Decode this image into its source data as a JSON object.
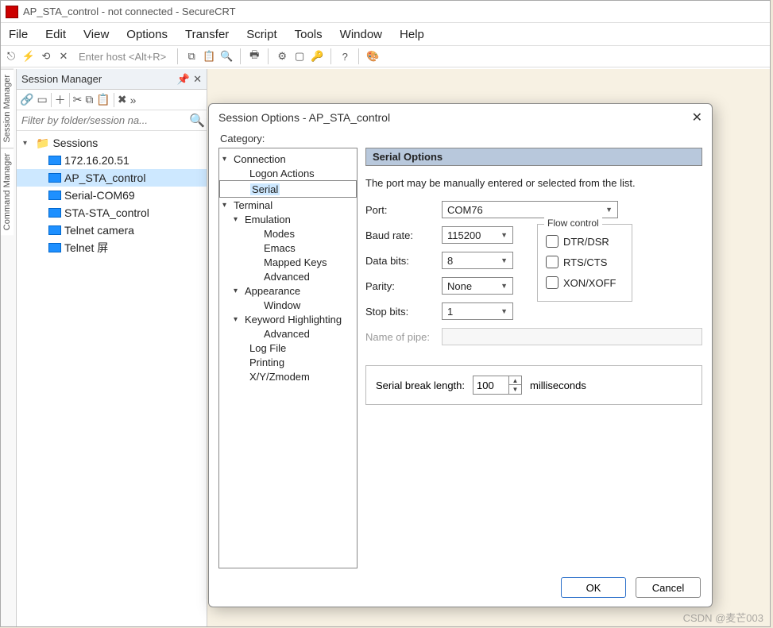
{
  "window": {
    "title": "AP_STA_control - not connected - SecureCRT"
  },
  "menu": {
    "file": "File",
    "edit": "Edit",
    "view": "View",
    "options": "Options",
    "transfer": "Transfer",
    "script": "Script",
    "tools": "Tools",
    "window": "Window",
    "help": "Help"
  },
  "toolbar": {
    "enter_host": "Enter host <Alt+R>"
  },
  "side_tabs": {
    "session": "Session Manager",
    "command": "Command Manager"
  },
  "session_panel": {
    "title": "Session Manager",
    "filter_placeholder": "Filter by folder/session na...",
    "root": "Sessions",
    "items": [
      "172.16.20.51",
      "AP_STA_control",
      "Serial-COM69",
      "STA-STA_control",
      "Telnet camera",
      "Telnet 屏"
    ]
  },
  "dialog": {
    "title": "Session Options - AP_STA_control",
    "category_label": "Category:",
    "tree": {
      "connection": "Connection",
      "logon": "Logon Actions",
      "serial": "Serial",
      "terminal": "Terminal",
      "emulation": "Emulation",
      "modes": "Modes",
      "emacs": "Emacs",
      "mapped": "Mapped Keys",
      "advanced1": "Advanced",
      "appearance": "Appearance",
      "window": "Window",
      "keyword": "Keyword Highlighting",
      "advanced2": "Advanced",
      "logfile": "Log File",
      "printing": "Printing",
      "xyz": "X/Y/Zmodem"
    },
    "section": "Serial Options",
    "desc": "The port may be manually entered or selected from the list.",
    "labels": {
      "port": "Port:",
      "baud": "Baud rate:",
      "databits": "Data bits:",
      "parity": "Parity:",
      "stopbits": "Stop bits:",
      "pipe": "Name of pipe:"
    },
    "values": {
      "port": "COM76",
      "baud": "115200",
      "databits": "8",
      "parity": "None",
      "stopbits": "1"
    },
    "flow": {
      "legend": "Flow control",
      "dtr": "DTR/DSR",
      "rts": "RTS/CTS",
      "xon": "XON/XOFF"
    },
    "break": {
      "label": "Serial break length:",
      "value": "100",
      "unit": "milliseconds"
    },
    "buttons": {
      "ok": "OK",
      "cancel": "Cancel"
    }
  },
  "watermark": "CSDN @麦芒003"
}
